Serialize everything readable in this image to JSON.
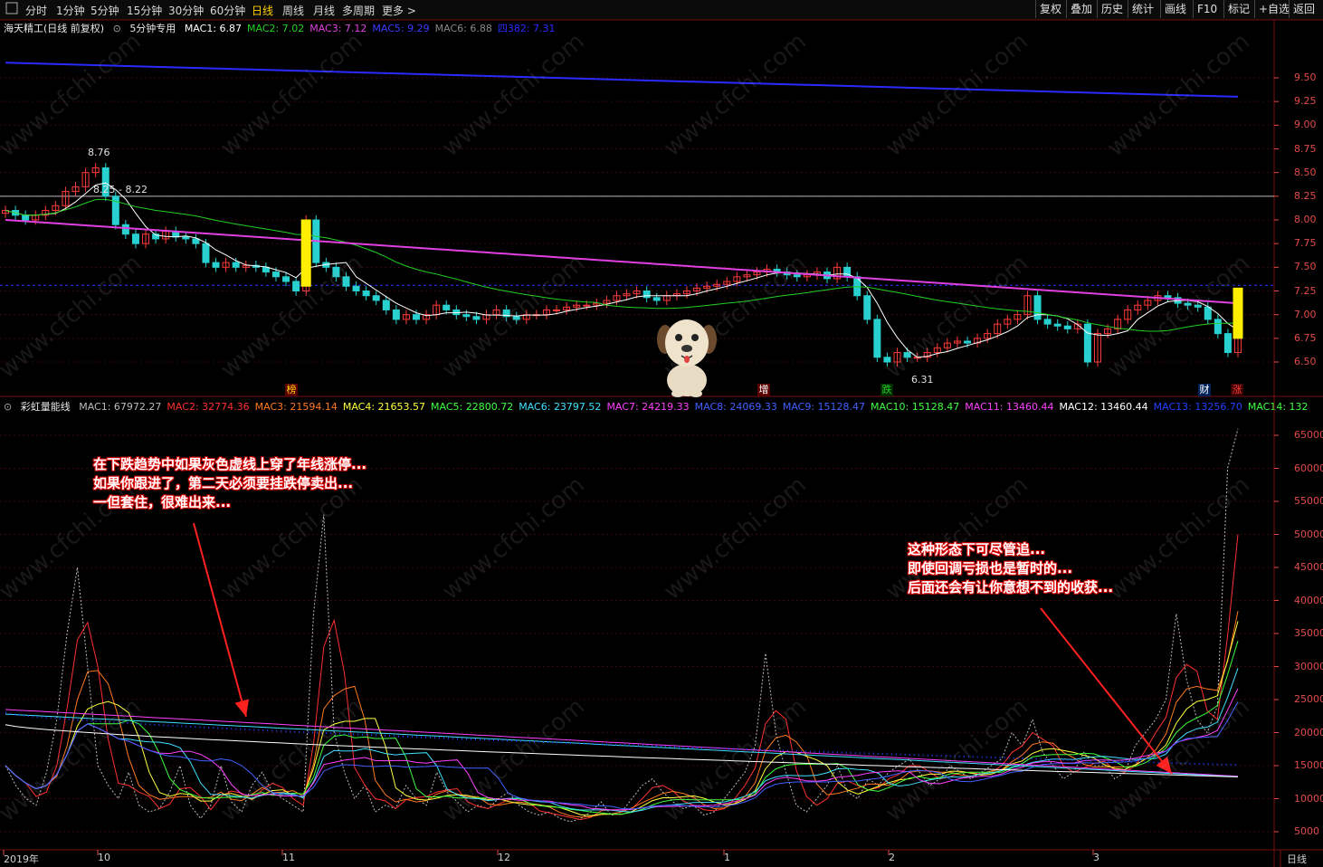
{
  "toolbar": {
    "periods": [
      "分时",
      "1分钟",
      "5分钟",
      "15分钟",
      "30分钟",
      "60分钟",
      "日线",
      "周线",
      "月线",
      "多周期",
      "更多 >"
    ],
    "active_period": "日线",
    "buttons": [
      "复权",
      "叠加",
      "历史",
      "统计",
      "画线",
      "F10",
      "标记",
      "+自选",
      "返回"
    ]
  },
  "price_panel": {
    "stock_title": "海天精工(日线 前复权)",
    "indicator_name": "5分钟专用",
    "legend": [
      {
        "label": "MAC1: 6.87",
        "color": "#ffffff"
      },
      {
        "label": "MAC2: 7.02",
        "color": "#22d022"
      },
      {
        "label": "MAC3: 7.12",
        "color": "#e040e0"
      },
      {
        "label": "MAC5: 9.29",
        "color": "#3a3aff"
      },
      {
        "label": "MAC6: 6.88",
        "color": "#888888"
      },
      {
        "label": "四382: 7.31",
        "color": "#2a2aff"
      }
    ],
    "high_label": "8.76",
    "ref_label": "8.25 - 8.22",
    "low_label": "6.31",
    "y_ticks": [
      "9.50",
      "9.25",
      "9.00",
      "8.75",
      "8.50",
      "8.25",
      "8.00",
      "7.75",
      "7.50",
      "7.25",
      "7.00",
      "6.75",
      "6.50"
    ],
    "markers": [
      {
        "text": "榜",
        "color": "#ffd200",
        "bg": "#5a0000"
      },
      {
        "text": "增",
        "color": "#ffffff",
        "bg": "#5a0000"
      },
      {
        "text": "跌",
        "color": "#22d022",
        "bg": "#002a00"
      },
      {
        "text": "财",
        "color": "#ffffff",
        "bg": "#00205a"
      },
      {
        "text": "涨",
        "color": "#ff4040",
        "bg": "#3a0000"
      }
    ]
  },
  "volume_panel": {
    "indicator_name": "彩虹量能线",
    "legend": [
      {
        "label": "MAC1: 67972.27",
        "color": "#bbbbbb"
      },
      {
        "label": "MAC2: 32774.36",
        "color": "#ff3030"
      },
      {
        "label": "MAC3: 21594.14",
        "color": "#ff7a20"
      },
      {
        "label": "MAC4: 21653.57",
        "color": "#ffff40"
      },
      {
        "label": "MAC5: 22800.72",
        "color": "#40ff40"
      },
      {
        "label": "MAC6: 23797.52",
        "color": "#40e0ff"
      },
      {
        "label": "MAC7: 24219.33",
        "color": "#ff40ff"
      },
      {
        "label": "MAC8: 24069.33",
        "color": "#4060ff"
      },
      {
        "label": "MAC9: 15128.47",
        "color": "#4060ff"
      },
      {
        "label": "MAC10: 15128.47",
        "color": "#40ff40"
      },
      {
        "label": "MAC11: 13460.44",
        "color": "#ff40ff"
      },
      {
        "label": "MAC12: 13460.44",
        "color": "#ffffff"
      },
      {
        "label": "MAC13: 13256.70",
        "color": "#2040ff"
      },
      {
        "label": "MAC14: 132",
        "color": "#40ff40"
      }
    ],
    "y_ticks": [
      "65000",
      "60000",
      "55000",
      "50000",
      "45000",
      "40000",
      "35000",
      "30000",
      "25000",
      "20000",
      "15000",
      "10000",
      "5000"
    ],
    "annotation_left": [
      "在下跌趋势中如果灰色虚线上穿了年线涨停...",
      "如果你跟进了，第二天必须要挂跌停卖出...",
      "一但套住，很难出来..."
    ],
    "annotation_right": [
      "这种形态下可尽管追...",
      "即使回调亏损也是暂时的...",
      "后面还会有让你意想不到的收获..."
    ]
  },
  "x_axis": {
    "labels": [
      "2019年",
      "10",
      "11",
      "12",
      "1",
      "2",
      "3"
    ],
    "period_label": "日线"
  },
  "watermark": "www.cfchi.com",
  "chart_data": {
    "type": "candlestick",
    "price_ylim": [
      6.4,
      9.7
    ],
    "volume_ylim": [
      3000,
      67000
    ],
    "yearline_start": 9.66,
    "yearline_end": 9.3,
    "high": 8.76,
    "low": 6.31,
    "closes": [
      8.1,
      8.05,
      8.0,
      8.05,
      8.1,
      8.15,
      8.3,
      8.35,
      8.5,
      8.55,
      8.25,
      7.95,
      7.85,
      7.75,
      7.85,
      7.8,
      7.88,
      7.82,
      7.8,
      7.75,
      7.55,
      7.5,
      7.55,
      7.5,
      7.52,
      7.5,
      7.45,
      7.4,
      7.35,
      7.25,
      8.0,
      7.55,
      7.5,
      7.4,
      7.3,
      7.25,
      7.2,
      7.15,
      7.05,
      6.95,
      7.0,
      6.95,
      7.0,
      7.1,
      7.05,
      7.0,
      6.98,
      6.95,
      7.0,
      7.05,
      6.98,
      6.95,
      7.0,
      7.0,
      7.05,
      7.05,
      7.08,
      7.1,
      7.1,
      7.12,
      7.15,
      7.2,
      7.22,
      7.25,
      7.18,
      7.15,
      7.2,
      7.22,
      7.25,
      7.28,
      7.3,
      7.32,
      7.35,
      7.4,
      7.42,
      7.45,
      7.48,
      7.45,
      7.42,
      7.4,
      7.42,
      7.45,
      7.38,
      7.5,
      7.4,
      7.2,
      6.95,
      6.55,
      6.5,
      6.6,
      6.55,
      6.55,
      6.6,
      6.65,
      6.7,
      6.72,
      6.7,
      6.75,
      6.8,
      6.9,
      6.95,
      7.0,
      7.2,
      6.95,
      6.9,
      6.88,
      6.85,
      6.9,
      6.5,
      6.8,
      6.85,
      6.95,
      7.05,
      7.1,
      7.15,
      7.2,
      7.18,
      7.12,
      7.1,
      7.08,
      6.95,
      6.8,
      6.6,
      6.75
    ],
    "volume_mac1": [
      15000,
      12000,
      10000,
      9000,
      14000,
      22000,
      35000,
      45000,
      30000,
      15000,
      12000,
      10000,
      14000,
      9000,
      8000,
      8500,
      11000,
      15000,
      9000,
      7000,
      9000,
      15000,
      9500,
      8000,
      12000,
      14000,
      11000,
      10000,
      9000,
      8000,
      38000,
      53000,
      20000,
      14000,
      10000,
      12000,
      8000,
      9000,
      8500,
      12000,
      10000,
      9000,
      14000,
      11000,
      9500,
      8000,
      9000,
      8500,
      10000,
      11000,
      9000,
      8000,
      7500,
      8000,
      7000,
      6500,
      7000,
      8000,
      9500,
      7500,
      8000,
      10000,
      12000,
      13000,
      11000,
      9500,
      8500,
      9000,
      7500,
      8000,
      10000,
      12000,
      14000,
      18000,
      32000,
      20000,
      14000,
      9000,
      8000,
      10000,
      12000,
      15000,
      11000,
      10000,
      13000,
      12000,
      14000,
      15000,
      16000,
      14000,
      12000,
      13000,
      15000,
      14000,
      13000,
      14000,
      15000,
      16000,
      20000,
      18000,
      22000,
      17000,
      15000,
      13000,
      14000,
      17000,
      15000,
      15000,
      13000,
      14000,
      18000,
      20000,
      22000,
      25000,
      38000,
      28000,
      22000,
      20000,
      24000,
      60000,
      66000
    ],
    "volume_mac9_start": 23000,
    "volume_mac9_end": 15100,
    "volume_mac11_start": 23500,
    "volume_mac11_end": 13400
  }
}
